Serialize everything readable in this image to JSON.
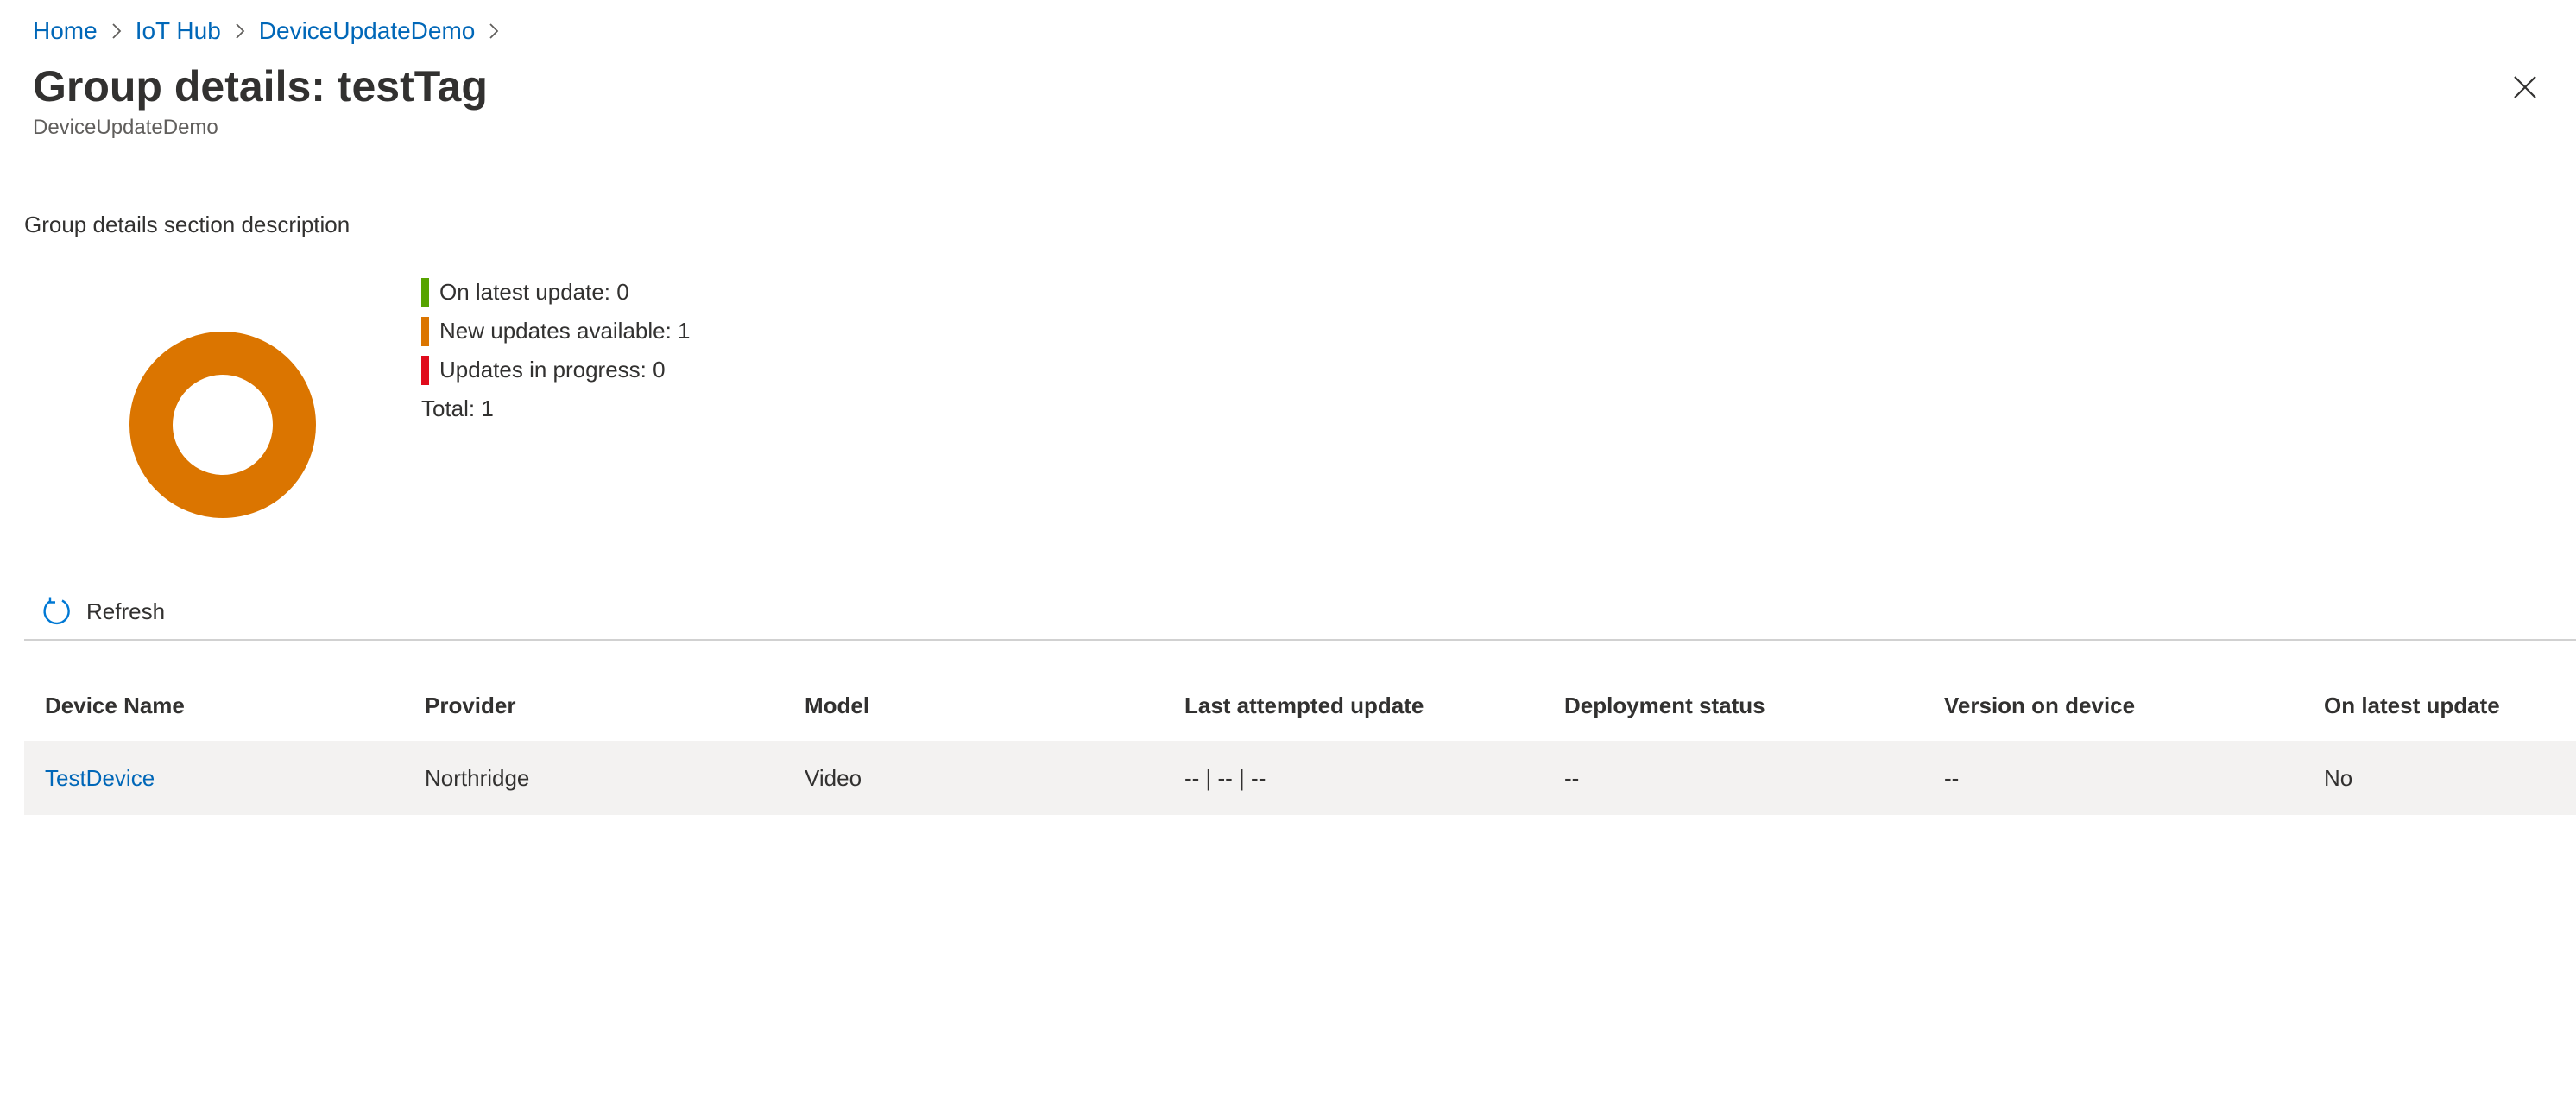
{
  "breadcrumb": {
    "items": [
      {
        "label": "Home"
      },
      {
        "label": "IoT Hub"
      },
      {
        "label": "DeviceUpdateDemo"
      }
    ]
  },
  "header": {
    "title": "Group details: testTag",
    "subtitle": "DeviceUpdateDemo"
  },
  "section": {
    "description": "Group details section description"
  },
  "summary": {
    "legend": [
      {
        "label": "On latest update: 0",
        "color": "#57a300"
      },
      {
        "label": "New updates available: 1",
        "color": "#db7500"
      },
      {
        "label": "Updates in progress: 0",
        "color": "#e00b1c"
      }
    ],
    "total_label": "Total: 1",
    "donut_color": "#db7500"
  },
  "commands": {
    "refresh_label": "Refresh"
  },
  "table": {
    "columns": [
      "Device Name",
      "Provider",
      "Model",
      "Last attempted update",
      "Deployment status",
      "Version on device",
      "On latest update"
    ],
    "rows": [
      {
        "device_name": "TestDevice",
        "provider": "Northridge",
        "model": "Video",
        "last_attempted_update": "-- | -- | --",
        "deployment_status": "--",
        "version_on_device": "--",
        "on_latest_update": "No"
      }
    ]
  },
  "icons": {
    "close": "close-icon",
    "refresh": "refresh-icon",
    "breadcrumb_separator": "chevron-right-icon"
  }
}
